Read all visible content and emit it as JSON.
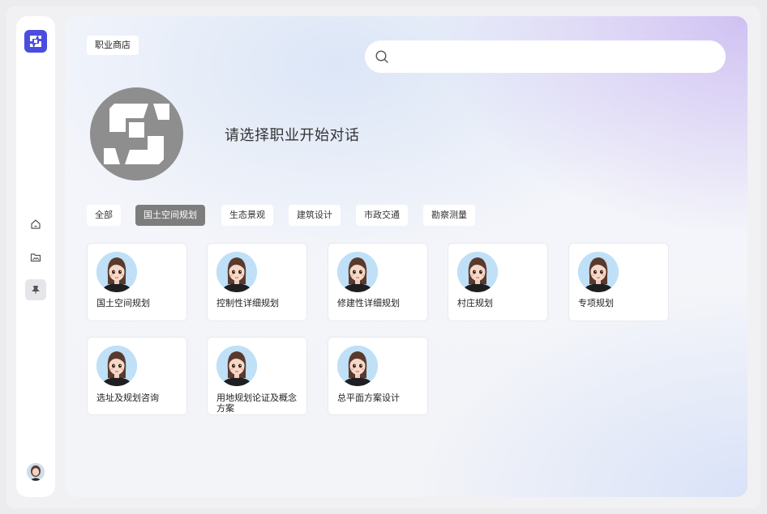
{
  "store": {
    "label": "职业商店"
  },
  "search": {
    "placeholder": "",
    "value": ""
  },
  "hero": {
    "headline": "请选择职业开始对话"
  },
  "tabs": [
    {
      "label": "全部",
      "active": false
    },
    {
      "label": "国土空间规划",
      "active": true
    },
    {
      "label": "生态景观",
      "active": false
    },
    {
      "label": "建筑设计",
      "active": false
    },
    {
      "label": "市政交通",
      "active": false
    },
    {
      "label": "勘察测量",
      "active": false
    }
  ],
  "cards": [
    {
      "title": "国土空间规划"
    },
    {
      "title": "控制性详细规划"
    },
    {
      "title": "修建性详细规划"
    },
    {
      "title": "村庄规划"
    },
    {
      "title": "专项规划"
    },
    {
      "title": "选址及规划咨询"
    },
    {
      "title": "用地规划论证及概念方案"
    },
    {
      "title": "总平面方案设计"
    }
  ],
  "sidebar": {
    "items": [
      {
        "icon": "home-icon"
      },
      {
        "icon": "image-folder-icon"
      },
      {
        "icon": "pin-icon",
        "active": true
      }
    ]
  },
  "colors": {
    "brand": "#4b4de0",
    "active_tab": "#7d7d7d",
    "logo_grey": "#8e8e8e"
  }
}
